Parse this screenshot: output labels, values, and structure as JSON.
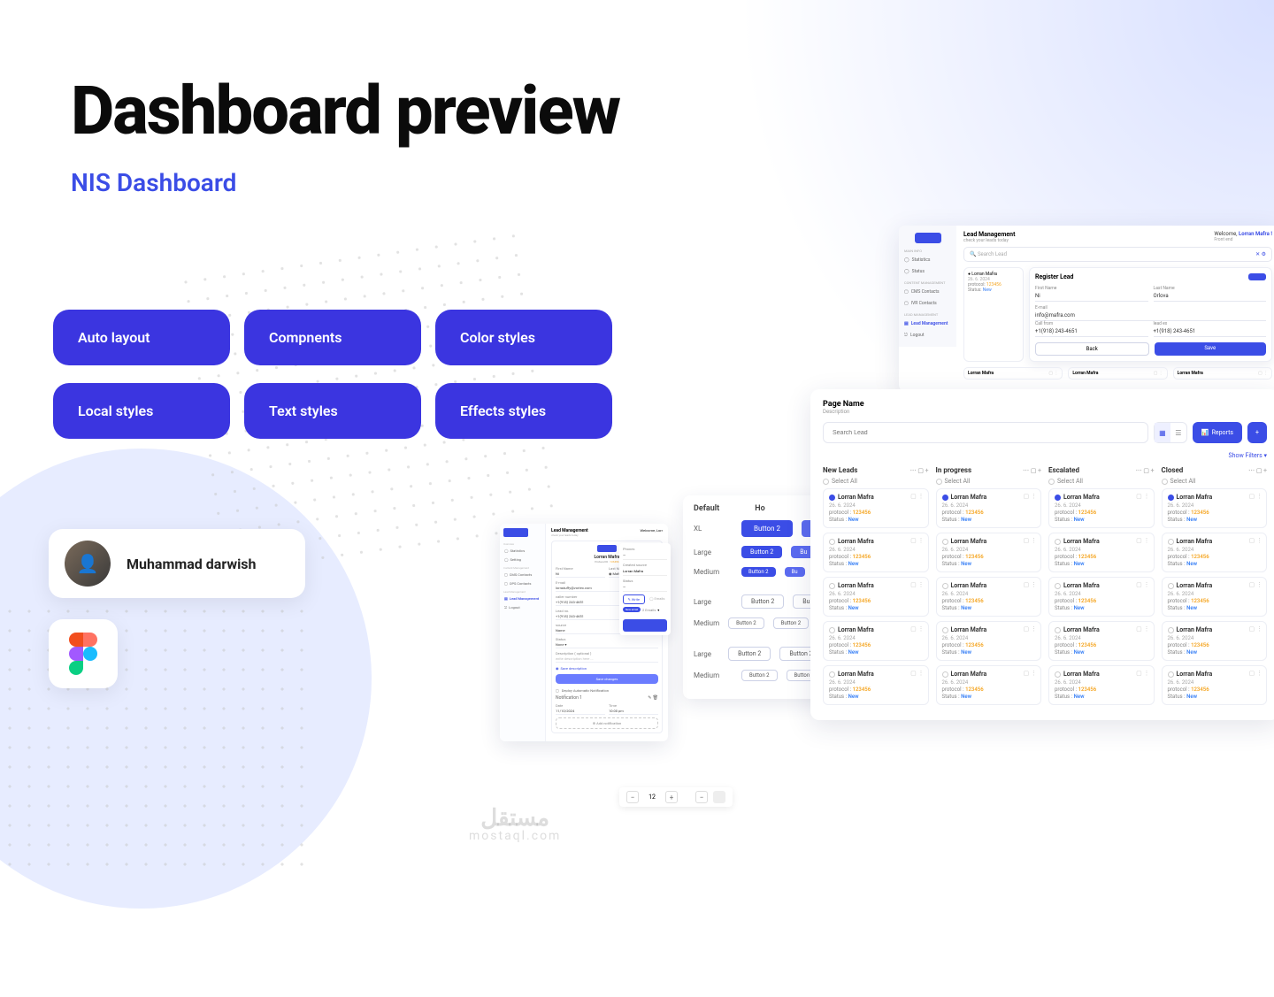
{
  "title": "Dashboard preview",
  "subtitle": "NIS Dashboard",
  "pills": [
    "Auto layout",
    "Compnents",
    "Color styles",
    "Local styles",
    "Text styles",
    "Effects styles"
  ],
  "author": {
    "name": "Muhammad darwish"
  },
  "watermark": {
    "ar": "مستقل",
    "en": "mostaql.com"
  },
  "board": {
    "page_name": "Page Name",
    "description": "Description",
    "search_placeholder": "Search Lead",
    "reports": "Reports",
    "filters": "Show Filters ▾",
    "columns": [
      "New Leads",
      "In progress",
      "Escalated",
      "Closed"
    ],
    "select_all": "Select All",
    "card": {
      "name": "Lorran Mafra",
      "date": "26. 6. 2024",
      "protocol_label": "protocol :",
      "protocol": "123456",
      "status_label": "Status :",
      "status": "New"
    }
  },
  "leadpanel": {
    "header": "Lead Management",
    "subheader": "check your leads today",
    "welcome_pre": "Welcome, ",
    "welcome_name": "Lorran Mafra !",
    "role": "Front end",
    "search": "Search Lead",
    "nav_main": "Main Info",
    "nav_items": [
      "Statistics",
      "Status"
    ],
    "nav_cm": "Content Management",
    "nav_cm_items": [
      "CMS Contacts",
      "IVR Contacts"
    ],
    "nav_lm": "Lead Management",
    "nav_lm_item": "Lead Management",
    "nav_logout": "Logout",
    "register": {
      "title": "Register Lead",
      "first_name_l": "First Name",
      "first_name": "Ni",
      "last_name_l": "Last Name",
      "last_name": "Orlova",
      "email_l": "E-mail",
      "email": "info@mafra.com",
      "call_from_l": "Call from",
      "call_from": "+1(918) 243-4651",
      "lead_ex_l": "lead ex",
      "lead_ex": "+1(918) 243-4651",
      "back": "Back",
      "save": "Save"
    }
  },
  "leadform": {
    "header": "Lead Management",
    "sub": "check your leads today",
    "welcome": "Welcome, Lorr",
    "nav_overview": "Overview",
    "nav_items": [
      "Statistics",
      "Setting"
    ],
    "nav_cm": "Content Management",
    "nav_cm_items": [
      "CMS Contacts",
      "OPS Contacts"
    ],
    "nav_lm": "Lead Management",
    "nav_lm_item": "Lead Management",
    "nav_logout": "Logout",
    "lead_name": "Lorran Mafra",
    "protocol_id_l": "Protocol ID :",
    "protocol_id": "123456",
    "first_name_l": "First Name",
    "first_name": "Ni",
    "last_name_l": "Last Name",
    "last_name": "Mafra",
    "email_l": "E-mail",
    "email": "lorraduffy@vortex.com",
    "caller_num_l": "caller number",
    "caller_num": "+1(918) 243-4651",
    "lead_no_l": "Lead no.",
    "lead_no": "+1(918) 243-4651",
    "source_l": "source",
    "source": "Name",
    "status_l": "Status",
    "status": "None",
    "desc_l": "Description ( optional )",
    "desc": "write description here ...",
    "save_desc": "Save description",
    "save_changes": "Save changes",
    "notify": "Deploy Automatic Notification",
    "notif_label": "Notification 1",
    "date_l": "Date",
    "date": "11/10/2024",
    "time_l": "Time",
    "time": "10:00 pm",
    "add_notif": "Add notification"
  },
  "rpanel": {
    "phone_l": "Phones",
    "created_l": "Created source",
    "created": "Lorran Mafra",
    "status_l": "Status",
    "write": "Write",
    "emails": "Emails",
    "new_email": "New email",
    "emailc": "2 Emails"
  },
  "matrix": {
    "head_default": "Default",
    "head_ho": "Ho",
    "sizes": [
      "XL",
      "Large",
      "Medium"
    ],
    "sizes2": [
      "Large",
      "Medium"
    ],
    "sizes3": [
      "Large",
      "Medium"
    ],
    "btn_label": "Button 2"
  },
  "counter": {
    "value": "12"
  }
}
